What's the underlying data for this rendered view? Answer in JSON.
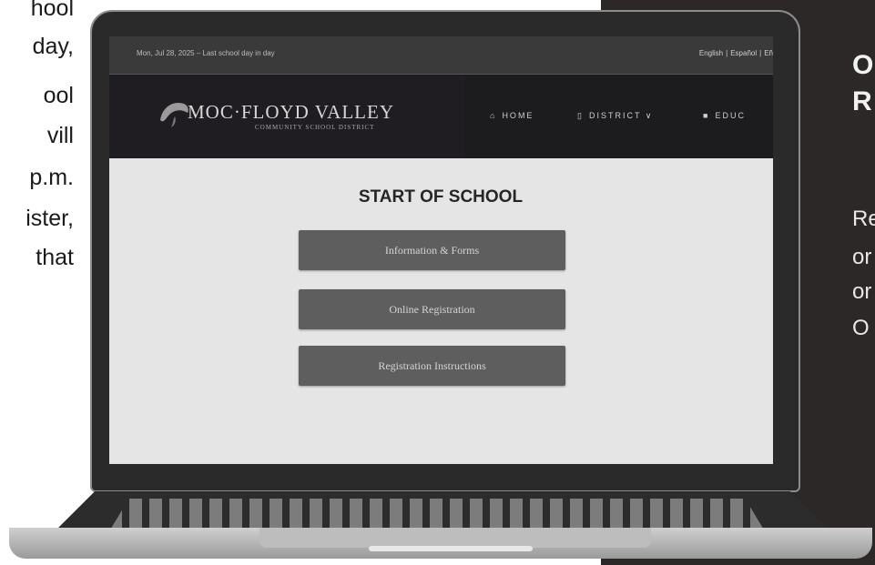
{
  "left_article": {
    "lines": [
      "hool",
      "day,",
      "ool",
      "vill",
      "p.m.",
      "ister,",
      "that"
    ]
  },
  "right_panel": {
    "heading_lines": [
      "O",
      "R"
    ],
    "paragraph_lines": [
      "Re",
      "or",
      "or",
      "O"
    ]
  },
  "website": {
    "topbar": {
      "date_text": "Mon, Jul 28, 2025 – Last school day in day",
      "languages": [
        "English",
        "|",
        "Español",
        "|",
        "Eñ"
      ]
    },
    "logo": {
      "name": "MOC·FLOYD VALLEY",
      "subtitle": "COMMUNITY SCHOOL DISTRICT"
    },
    "nav": [
      {
        "icon": "home-icon",
        "glyph": "⌂",
        "label": "HOME"
      },
      {
        "icon": "building-icon",
        "glyph": "▯",
        "label": "DISTRICT ∨"
      },
      {
        "icon": "book-icon",
        "glyph": "■",
        "label": "EDUC"
      }
    ],
    "main": {
      "title": "START OF SCHOOL",
      "buttons": [
        "Information & Forms",
        "Online Registration",
        "Registration Instructions"
      ]
    }
  },
  "colors": {
    "right_panel_bg": "#2b2827",
    "screen_bg": "#e5e5e5",
    "header_bg": "#1c1b1d",
    "button_bg": "#5e5e5e"
  }
}
